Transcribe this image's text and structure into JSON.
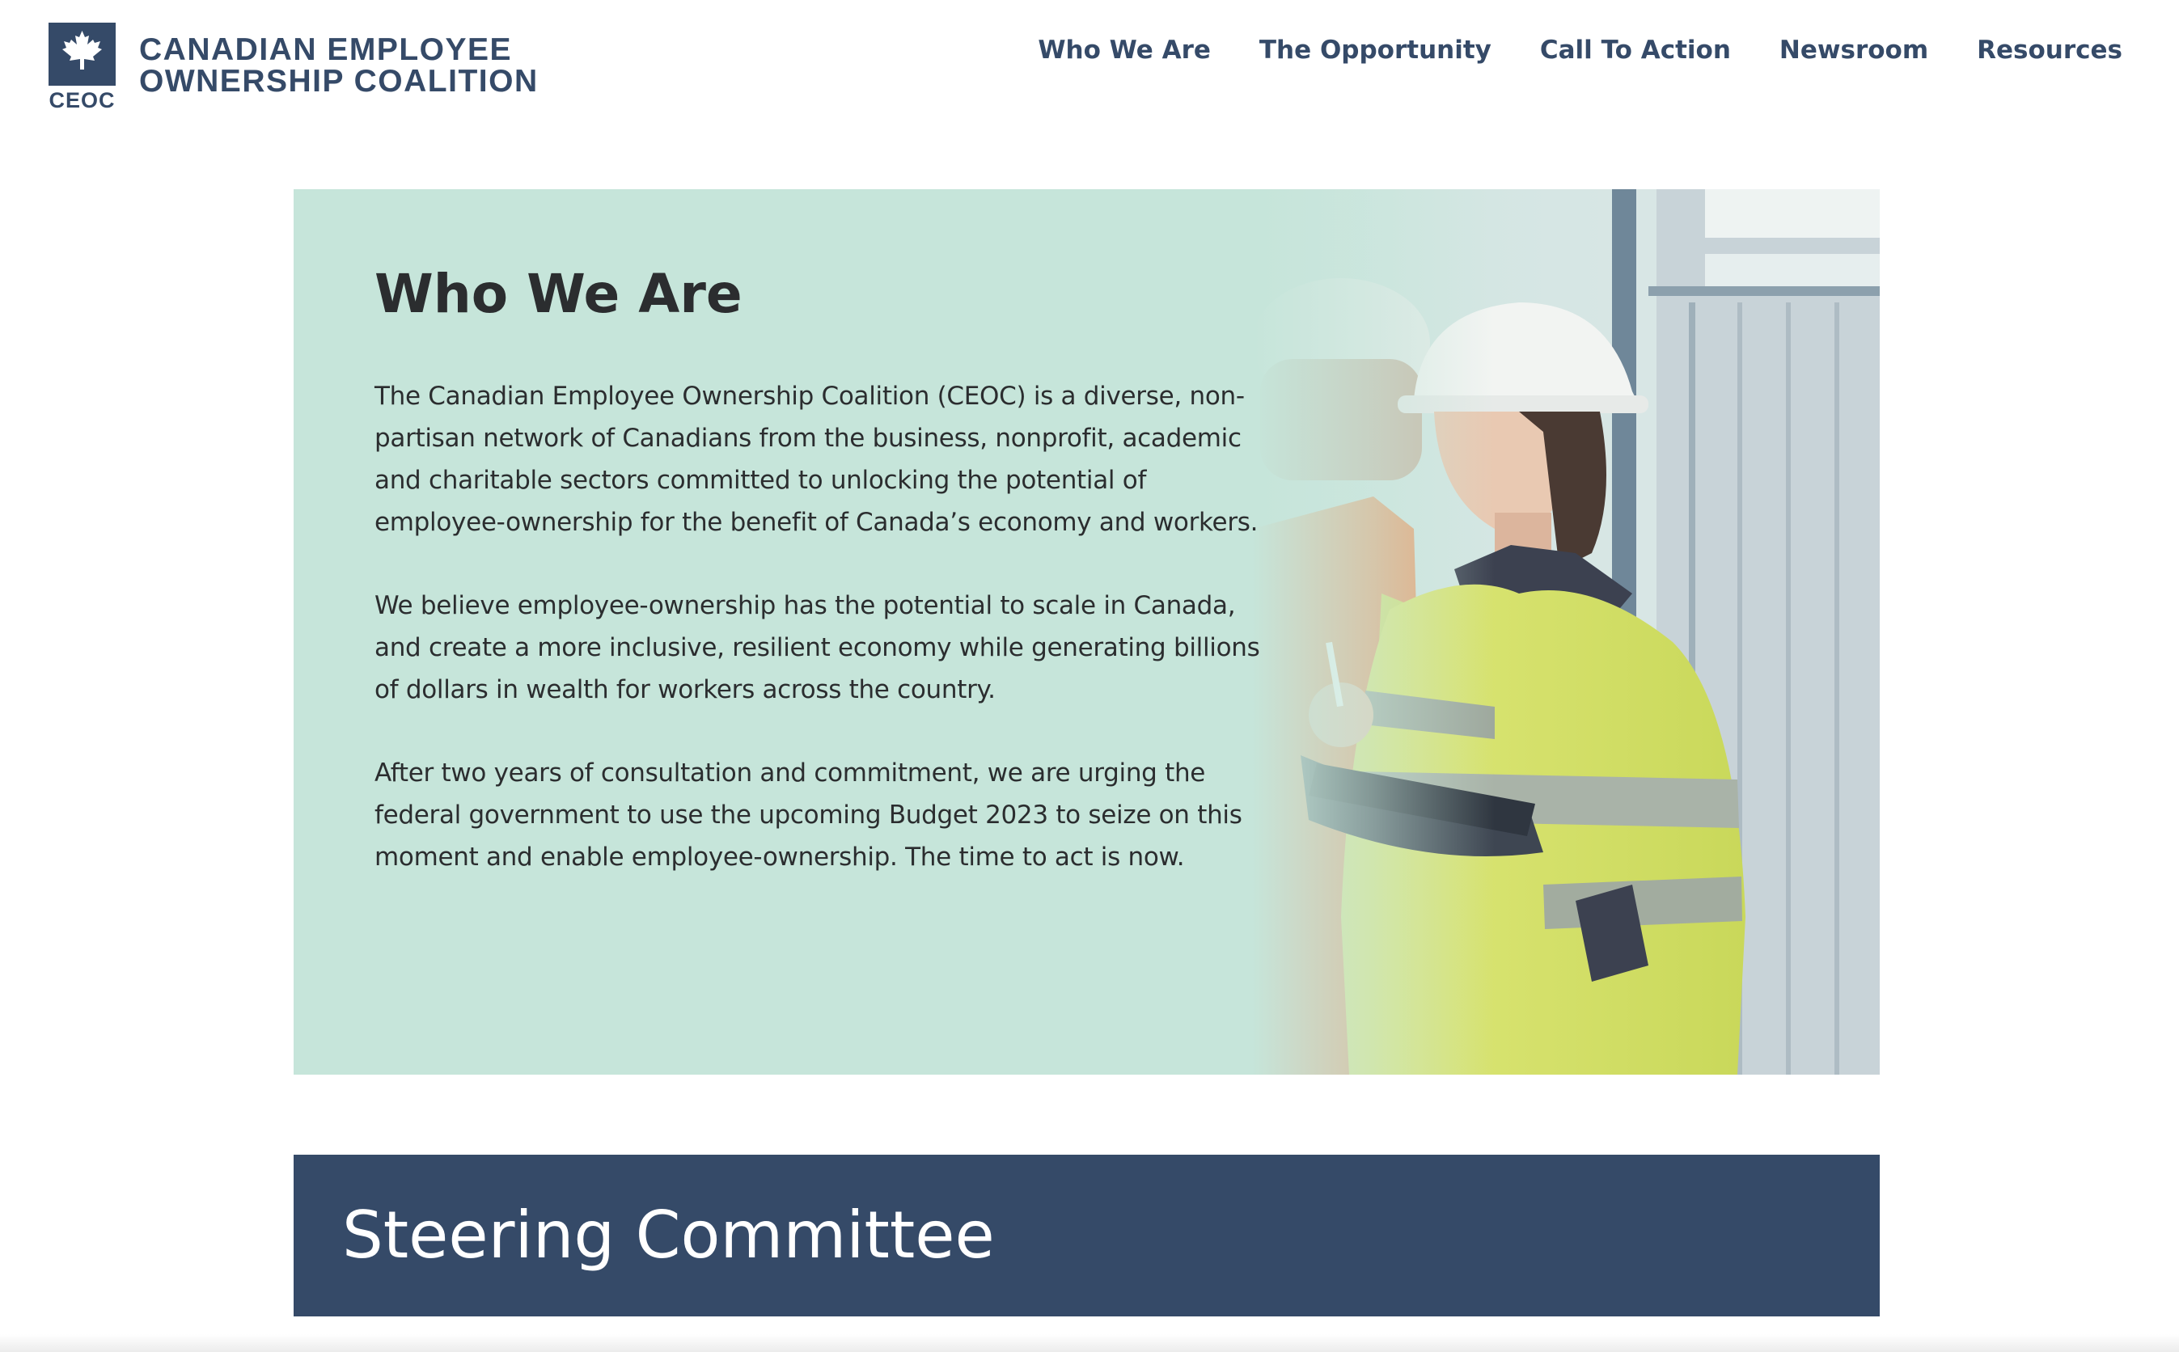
{
  "brand": {
    "abbreviation": "CEOC",
    "name_line1": "CANADIAN EMPLOYEE",
    "name_line2": "OWNERSHIP COALITION",
    "logo_icon": "maple-leaf-icon",
    "color": "#354a68"
  },
  "nav": {
    "items": [
      {
        "label": "Who We Are"
      },
      {
        "label": "The Opportunity"
      },
      {
        "label": "Call To Action"
      },
      {
        "label": "Newsroom"
      },
      {
        "label": "Resources"
      }
    ]
  },
  "hero": {
    "title": "Who We Are",
    "paragraphs": [
      "The Canadian Employee Ownership Coalition (CEOC) is a diverse, non-partisan network of Canadians from the business, nonprofit, academic and charitable sectors committed to unlocking the potential of employee-ownership for the benefit of Canada’s economy and workers.",
      "We believe employee-ownership has the potential to scale in Canada, and create a more inclusive, resilient economy while generating billions of dollars in wealth for workers across the country.",
      "After two years of consultation and commitment, we are urging the federal government to use the upcoming Budget 2023 to seize on this moment and enable employee-ownership. The time to act is now."
    ],
    "background_color": "#c6e5da"
  },
  "committee": {
    "title": "Steering Committee",
    "background_color": "#354a68"
  }
}
